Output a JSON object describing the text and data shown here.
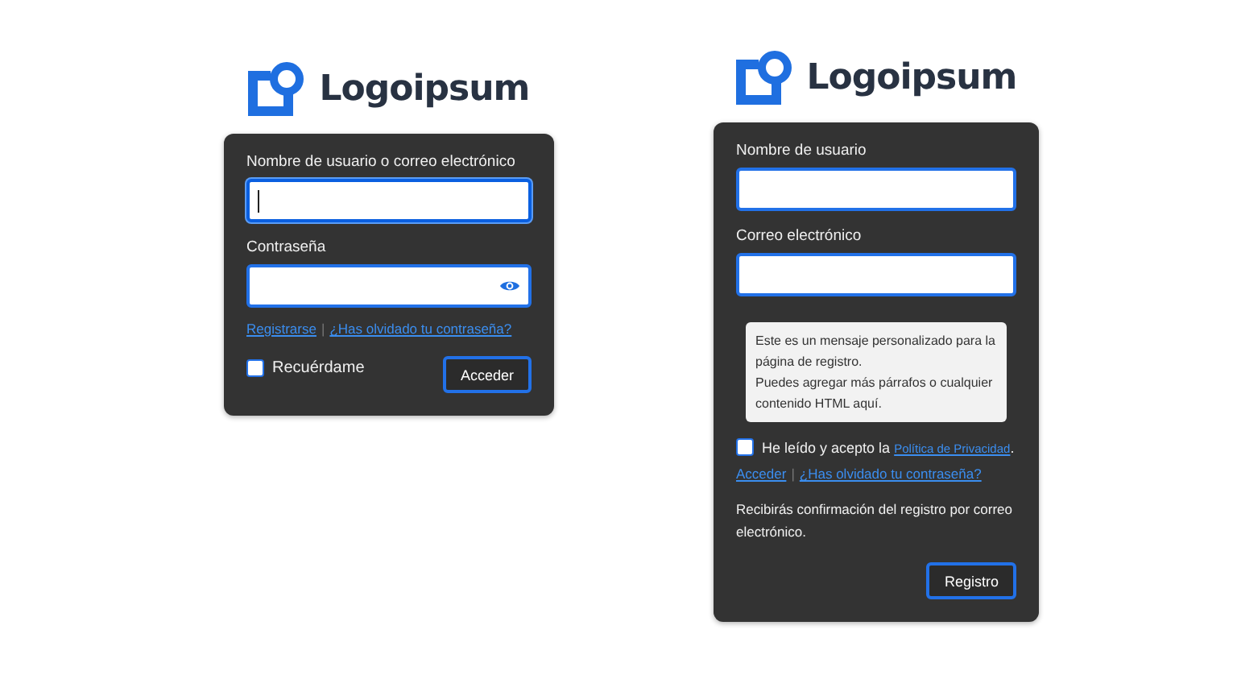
{
  "login": {
    "logo": "Logoipsum",
    "fields": [
      {
        "label": "Nombre de usuario o correo electrónico",
        "kind": "text",
        "focused": true
      },
      {
        "label": "Contraseña",
        "kind": "password",
        "focused": false
      }
    ],
    "links": [
      "Registrarse",
      "¿Has olvidado tu contraseña?"
    ],
    "separator": "|",
    "remember": {
      "label": "Recuérdame",
      "checked": false
    },
    "submit": "Acceder"
  },
  "register": {
    "logo": "Logoipsum",
    "fields": [
      {
        "label": "Nombre de usuario",
        "kind": "text",
        "focused": false
      },
      {
        "label": "Correo electrónico",
        "kind": "text",
        "focused": false
      }
    ],
    "notice": [
      "Este es un mensaje personalizado para la página de registro.",
      "Puedes agregar más párrafos o cualquier contenido HTML aquí."
    ],
    "consent": {
      "text": "He leído y acepto la",
      "link": "Política de Privacidad",
      "end": ".",
      "checked": false
    },
    "links": [
      "Acceder",
      "¿Has olvidado tu contraseña?"
    ],
    "separator": "|",
    "confirmation": "Recibirás confirmación del registro por correo electrónico.",
    "submit": "Registro"
  }
}
